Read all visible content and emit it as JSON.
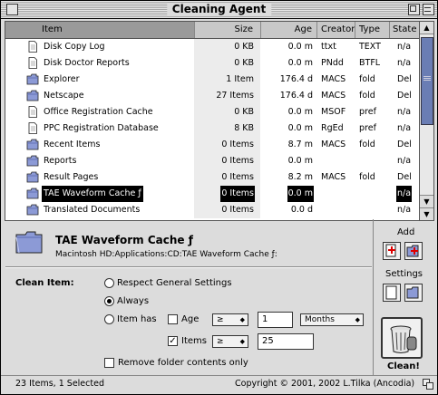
{
  "window": {
    "title": "Cleaning Agent"
  },
  "columns": [
    "Item",
    "Size",
    "Age",
    "Creator",
    "Type",
    "State"
  ],
  "rows": [
    {
      "icon": "document-icon",
      "name": "Disk Copy Log",
      "size": "0 KB",
      "age": "0.0 m",
      "creator": "ttxt",
      "type": "TEXT",
      "state": "n/a"
    },
    {
      "icon": "document-icon",
      "name": "Disk Doctor Reports",
      "size": "0 KB",
      "age": "0.0 m",
      "creator": "PNdd",
      "type": "BTFL",
      "state": "n/a"
    },
    {
      "icon": "folder-icon",
      "name": "Explorer",
      "size": "1 Item",
      "age": "176.4 d",
      "creator": "MACS",
      "type": "fold",
      "state": "Del"
    },
    {
      "icon": "folder-icon",
      "name": "Netscape",
      "size": "27 Items",
      "age": "176.4 d",
      "creator": "MACS",
      "type": "fold",
      "state": "Del"
    },
    {
      "icon": "document-icon",
      "name": "Office Registration Cache",
      "size": "0 KB",
      "age": "0.0 m",
      "creator": "MSOF",
      "type": "pref",
      "state": "n/a"
    },
    {
      "icon": "document-icon",
      "name": "PPC Registration Database",
      "size": "8 KB",
      "age": "0.0 m",
      "creator": "RgEd",
      "type": "pref",
      "state": "n/a"
    },
    {
      "icon": "folder-icon",
      "name": "Recent Items",
      "size": "0 Items",
      "age": "8.7 m",
      "creator": "MACS",
      "type": "fold",
      "state": "Del"
    },
    {
      "icon": "folder-icon",
      "name": "Reports",
      "size": "0 Items",
      "age": "0.0 m",
      "creator": "",
      "type": "",
      "state": "n/a"
    },
    {
      "icon": "folder-icon",
      "name": "Result Pages",
      "size": "0 Items",
      "age": "8.2 m",
      "creator": "MACS",
      "type": "fold",
      "state": "Del"
    },
    {
      "icon": "folder-icon",
      "name": "TAE Waveform Cache ƒ",
      "size": "0 Items",
      "age": "0.0 m",
      "creator": "",
      "type": "",
      "state": "n/a",
      "selected": true
    },
    {
      "icon": "folder-icon",
      "name": "Translated Documents",
      "size": "0 Items",
      "age": "0.0 d",
      "creator": "",
      "type": "",
      "state": "n/a"
    }
  ],
  "detail": {
    "title": "TAE Waveform Cache ƒ",
    "path": "Macintosh HD:Applications:CD:TAE Waveform Cache ƒ:"
  },
  "clean_item": {
    "label": "Clean Item:",
    "opt_general": "Respect General Settings",
    "opt_always": "Always",
    "opt_itemhas": "Item has",
    "age_label": "Age",
    "age_op": "≥",
    "age_value": "1",
    "age_unit": "Months",
    "items_label": "Items",
    "items_op": "≥",
    "items_value": "25",
    "remove_label": "Remove folder contents only"
  },
  "right": {
    "add_label": "Add",
    "settings_label": "Settings",
    "clean_label": "Clean!"
  },
  "status": {
    "left": "23 Items, 1 Selected",
    "right": "Copyright © 2001, 2002 L.Tilka (Ancodia)"
  }
}
